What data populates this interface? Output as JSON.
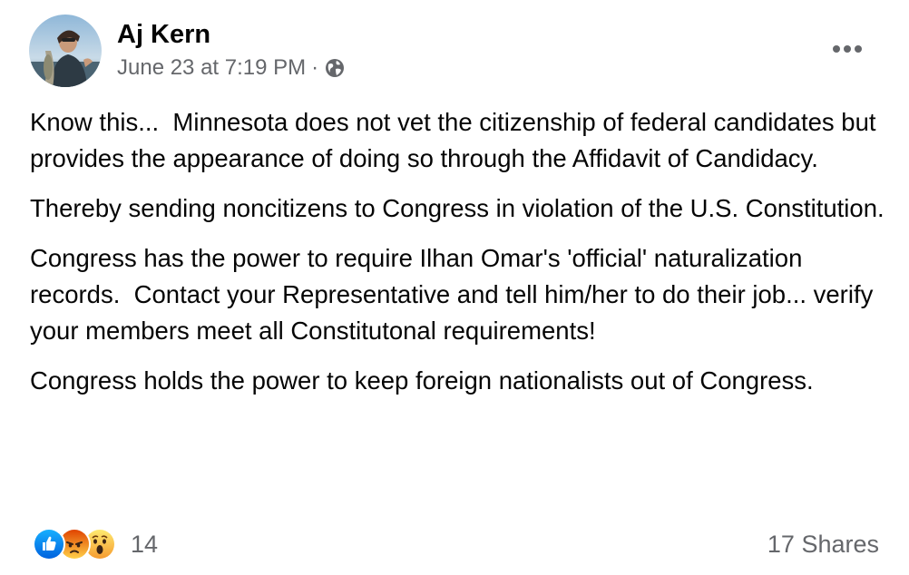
{
  "post": {
    "author": "Aj Kern",
    "timestamp": "June 23 at 7:19 PM",
    "separator": "·",
    "privacy_icon": "globe-icon",
    "more_icon": "more-options-icon",
    "paragraphs": [
      "Know this...  Minnesota does not vet the citizenship of federal candidates but provides the appearance of doing so through the Affidavit of Candidacy.",
      "Thereby sending noncitizens to Congress in violation of the U.S. Constitution.",
      "Congress has the power to require Ilhan Omar's 'official' naturalization records.  Contact your Representative and tell him/her to do their job... verify your members meet all Constitutonal requirements!",
      "Congress holds the power to keep foreign nationalists out of Congress."
    ]
  },
  "footer": {
    "reactions": [
      {
        "name": "like",
        "icon": "like-reaction-icon",
        "color": "#1877f2"
      },
      {
        "name": "angry",
        "icon": "angry-reaction-icon",
        "color": "#e9710f"
      },
      {
        "name": "wow",
        "icon": "wow-reaction-icon",
        "color": "#f7b125"
      }
    ],
    "reaction_count": "14",
    "shares": "17 Shares"
  }
}
